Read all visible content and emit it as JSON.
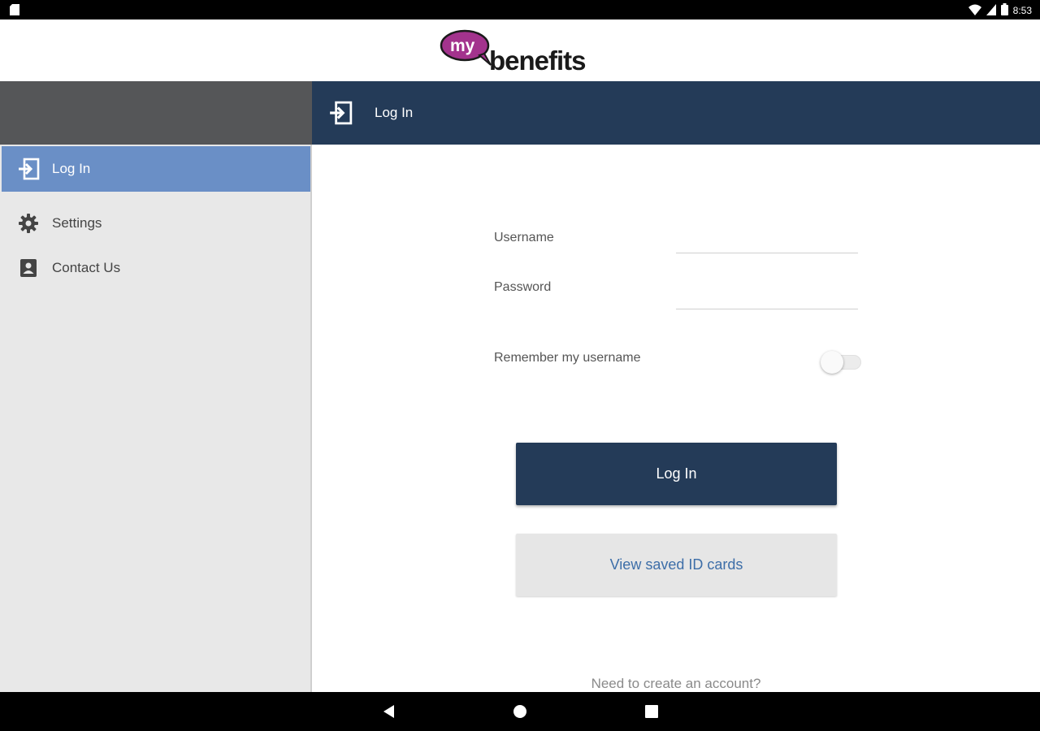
{
  "status_bar": {
    "time": "8:53",
    "icons": [
      "sd-card-icon",
      "wifi-icon",
      "signal-icon",
      "battery-icon"
    ]
  },
  "app": {
    "logo": {
      "word_my": "my",
      "word_benefits": "benefits",
      "brand_color": "#a3338d"
    }
  },
  "title_bar": {
    "title": "Log In",
    "icon": "login-icon"
  },
  "sidebar": {
    "items": [
      {
        "label": "Log In",
        "icon": "login-icon",
        "active": true
      },
      {
        "label": "Settings",
        "icon": "gear-icon",
        "active": false
      },
      {
        "label": "Contact Us",
        "icon": "contact-book-icon",
        "active": false
      }
    ]
  },
  "login_form": {
    "username_label": "Username",
    "username_value": "",
    "password_label": "Password",
    "password_value": "",
    "remember_label": "Remember my username",
    "remember_enabled": false,
    "login_button": "Log In",
    "saved_cards_button": "View saved ID cards",
    "create_account_link": "Need to create an account?"
  },
  "colors": {
    "primary": "#243b58",
    "sidebar_active": "#6a8fc6",
    "sidebar_bg": "#e8e8e8",
    "link": "#3d6ea8"
  },
  "system_nav": {
    "buttons": [
      "back-icon",
      "home-icon",
      "recents-icon"
    ]
  }
}
